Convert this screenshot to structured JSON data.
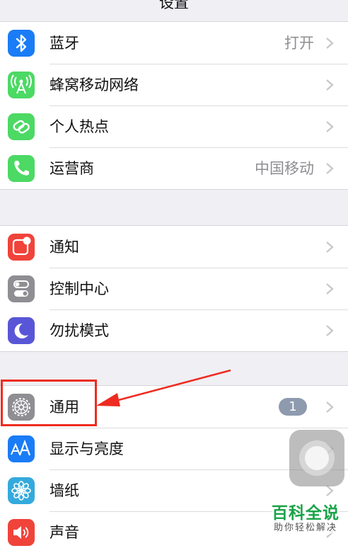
{
  "nav": {
    "title": "设置"
  },
  "group1": [
    {
      "label": "蓝牙",
      "value": "打开",
      "icon": "bluetooth-icon",
      "color": "#1a7cf6"
    },
    {
      "label": "蜂窝移动网络",
      "value": "",
      "icon": "cellular-antenna-icon",
      "color": "#4cd964"
    },
    {
      "label": "个人热点",
      "value": "",
      "icon": "hotspot-chain-icon",
      "color": "#4cd964"
    },
    {
      "label": "运营商",
      "value": "中国移动",
      "icon": "phone-icon",
      "color": "#4cd964"
    }
  ],
  "group2": [
    {
      "label": "通知",
      "icon": "notifications-icon",
      "color": "#f0433a"
    },
    {
      "label": "控制中心",
      "icon": "control-center-toggles-icon",
      "color": "#8e8e93"
    },
    {
      "label": "勿扰模式",
      "icon": "moon-icon",
      "color": "#5856d6"
    }
  ],
  "group3": [
    {
      "label": "通用",
      "badge": "1",
      "icon": "gear-icon",
      "color": "#8e8e93"
    },
    {
      "label": "显示与亮度",
      "icon": "text-size-aa-icon",
      "color": "#1a7cf6"
    },
    {
      "label": "墙纸",
      "icon": "wallpaper-flower-icon",
      "color": "#34aadc"
    },
    {
      "label": "声音",
      "icon": "speaker-icon",
      "color": "#f0433a"
    }
  ],
  "annotation": {
    "highlight_color": "#ee2b20"
  },
  "watermark": {
    "title": "百科全说",
    "subtitle": "助你轻松解决",
    "color": "#1aa348"
  }
}
